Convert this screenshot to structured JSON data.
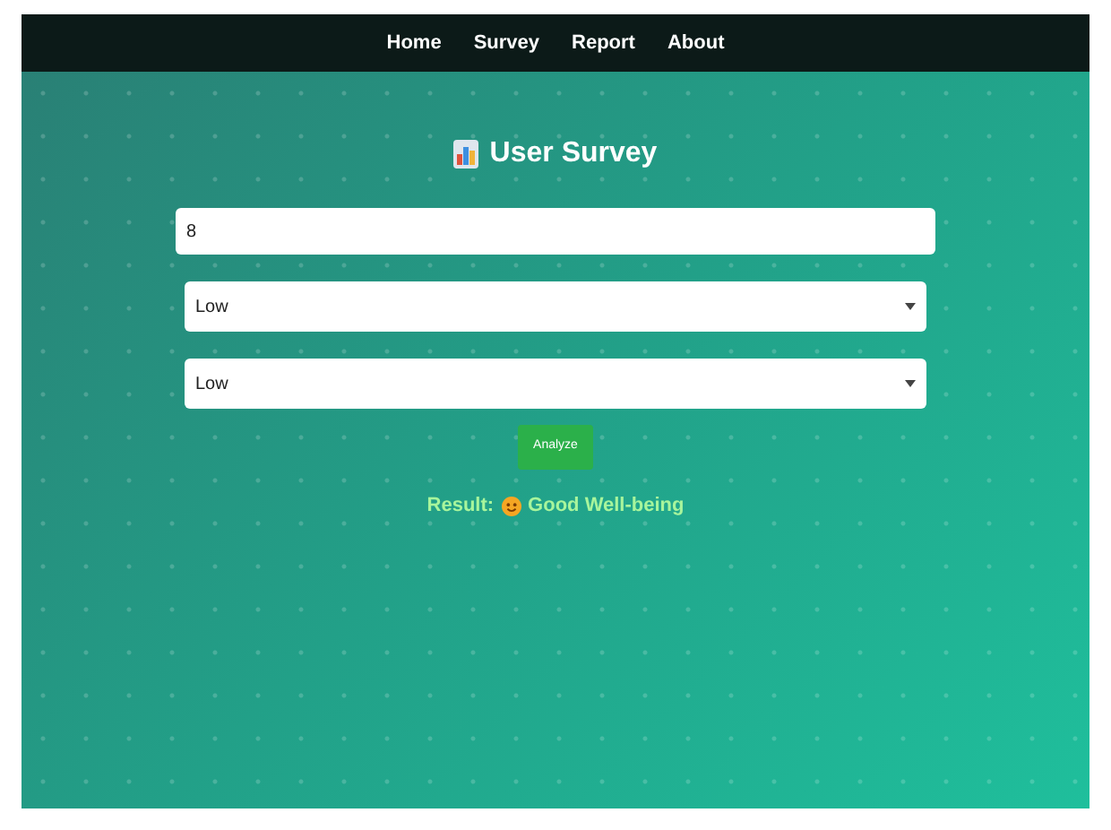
{
  "nav": {
    "items": [
      {
        "label": "Home"
      },
      {
        "label": "Survey"
      },
      {
        "label": "Report"
      },
      {
        "label": "About"
      }
    ]
  },
  "title": "User Survey",
  "form": {
    "text_field": {
      "value": "8"
    },
    "selects": [
      {
        "value": "Low"
      },
      {
        "value": "Low"
      }
    ],
    "button": "Analyze"
  },
  "result": {
    "label": "Result:",
    "value": "Good Well-being"
  }
}
